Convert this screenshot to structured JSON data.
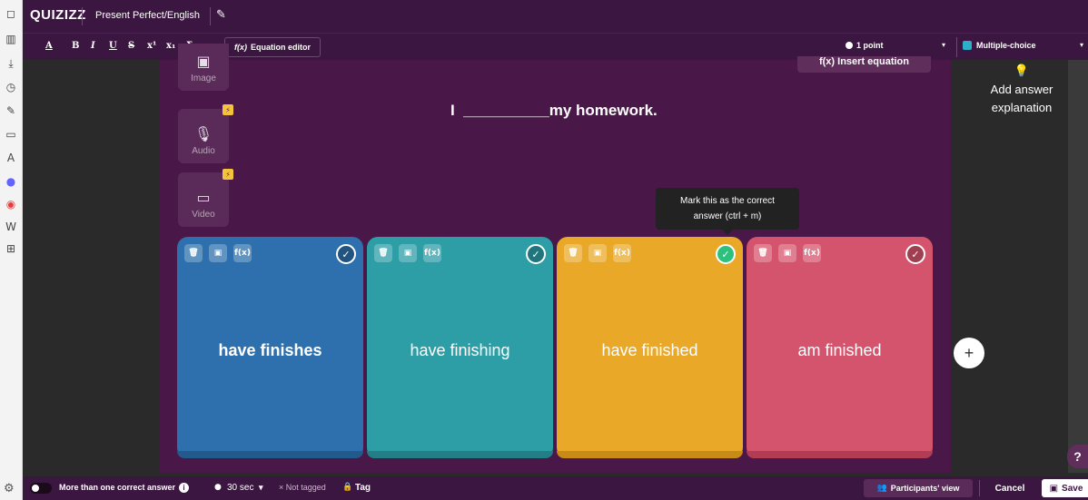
{
  "sidebar": {
    "icons": [
      "bookmark-icon",
      "book-icon",
      "download-icon",
      "history-icon",
      "edit-note-icon",
      "calendar-icon",
      "translate-icon",
      "mastodon-icon",
      "vivaldi-icon",
      "wikipedia-icon",
      "add-panel-icon",
      "settings-icon"
    ],
    "glyphs": [
      "◻",
      "▥",
      "⤓",
      "◷",
      "✎",
      "▭",
      "A",
      "●",
      "◉",
      "W",
      "⊞",
      "⚙"
    ]
  },
  "header": {
    "logo": "QUIZIZZ",
    "quiz_title": "Present Perfect/English",
    "edit_glyph": "✎"
  },
  "toolbar": {
    "text_color": "A",
    "bold": "B",
    "italic": "I",
    "underline": "U",
    "strike": "S",
    "superscript": "x¹",
    "subscript": "x₁",
    "sigma": "Σ",
    "equation_editor": "Equation editor",
    "fx": "f(x)",
    "points": "1 point",
    "question_type": "Multiple-choice",
    "caret": "▾"
  },
  "editor": {
    "insert_equation": "f(x) Insert equation",
    "question": "I  __________my homework.",
    "media": {
      "image": "Image",
      "audio": "Audio",
      "video": "Video"
    },
    "bolt": "⚡",
    "tooltip_line1": "Mark this as the correct",
    "tooltip_line2": "answer (ctrl + m)"
  },
  "answers": [
    {
      "text": "have finishes",
      "color": "#2d70ad",
      "bar": "#235a8c",
      "correct": false
    },
    {
      "text": "have finishing",
      "color": "#2d9da6",
      "bar": "#237e86",
      "correct": false
    },
    {
      "text": "have finished",
      "color": "#eaa828",
      "bar": "#c88b18",
      "correct": true
    },
    {
      "text": "am finished",
      "color": "#d5546d",
      "bar": "#b33c55",
      "correct": false
    }
  ],
  "answer_tools": {
    "delete": "🗑",
    "image": "▣",
    "fx": "f(x)",
    "check": "✓"
  },
  "right_panel": {
    "explanation_line1": "Add answer",
    "explanation_line2": "explanation",
    "bulb": "💡",
    "add": "+",
    "help": "?"
  },
  "footer": {
    "multiple_correct": "More than one correct answer",
    "info": "i",
    "time": "30 sec",
    "time_caret": "▾",
    "not_tagged": "× Not tagged",
    "tag": "Tag",
    "participants_view": "Participants' view",
    "cancel": "Cancel",
    "save": "Save"
  }
}
